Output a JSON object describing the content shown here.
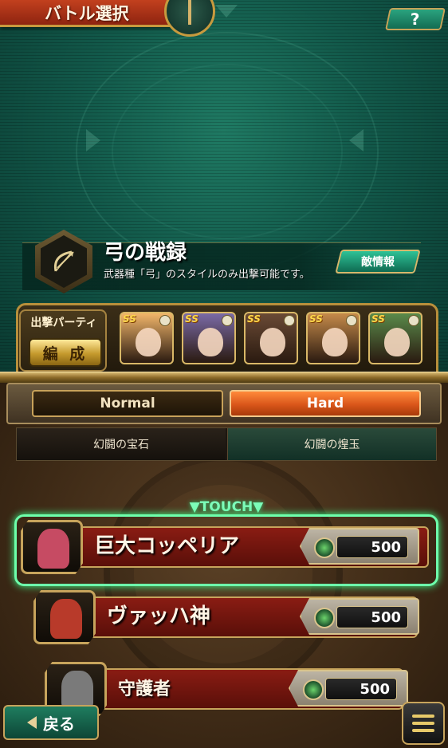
{
  "header": {
    "title": "バトル選択",
    "help_label": "?"
  },
  "battle": {
    "name": "弓の戦録",
    "description": "武器種「弓」のスタイルのみ出撃可能です。",
    "enemy_info_label": "敵情報",
    "weapon_icon": "bow-icon"
  },
  "party": {
    "label": "出撃パーティ",
    "formation_label": "編 成",
    "members": [
      {
        "rank": "SS",
        "color": "#f1b56a"
      },
      {
        "rank": "SS",
        "color": "#7a6aa6"
      },
      {
        "rank": "SS",
        "color": "#6a4a35"
      },
      {
        "rank": "SS",
        "color": "#c58a4a"
      },
      {
        "rank": "SS",
        "color": "#5a8a4a"
      }
    ]
  },
  "difficulty": {
    "options": [
      "Normal",
      "Hard"
    ],
    "selected": "Hard"
  },
  "rewards": {
    "tabs": [
      "幻闘の宝石",
      "幻闘の煌玉"
    ]
  },
  "touch_label": "▼TOUCH▼",
  "enemies": [
    {
      "name": "巨大コッペリア",
      "cost": "500",
      "color": "#c64b63"
    },
    {
      "name": "ヴァッハ神",
      "cost": "500",
      "color": "#b83a2a"
    },
    {
      "name": "守護者",
      "cost": "500",
      "color": "#7a7a7a"
    }
  ],
  "footer": {
    "back_label": "戻る"
  }
}
